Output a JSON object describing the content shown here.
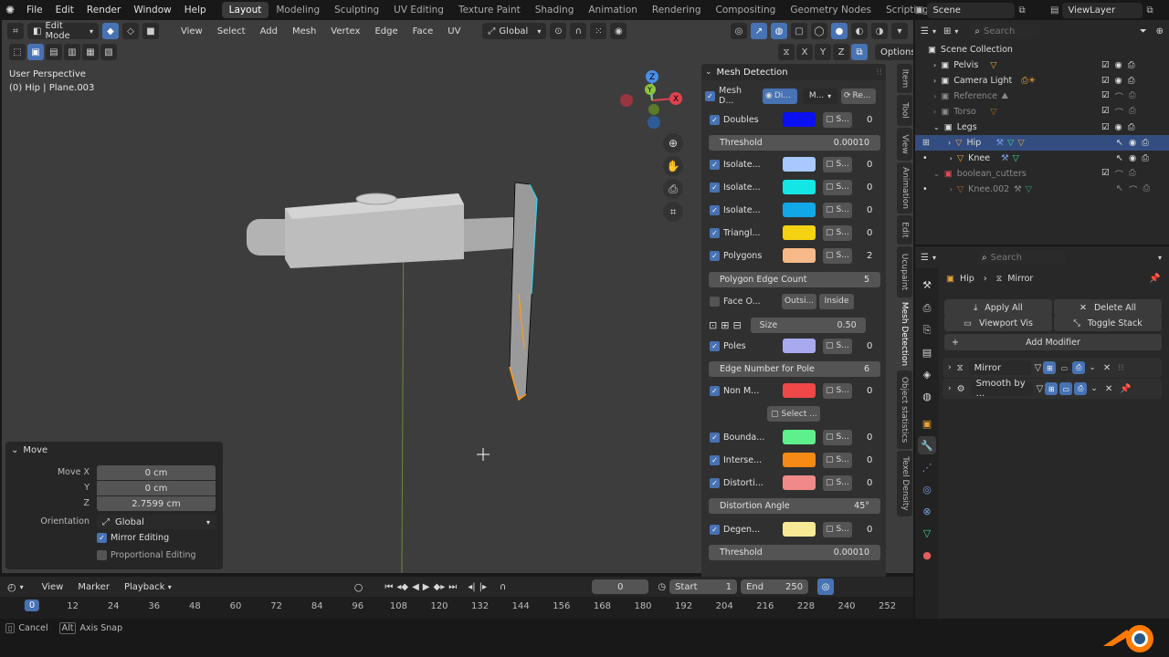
{
  "menubar": {
    "menus": [
      "File",
      "Edit",
      "Render",
      "Window",
      "Help"
    ],
    "workspaces": [
      "Layout",
      "Modeling",
      "Sculpting",
      "UV Editing",
      "Texture Paint",
      "Shading",
      "Animation",
      "Rendering",
      "Compositing",
      "Geometry Nodes",
      "Scripting"
    ],
    "active_workspace": "Layout",
    "scene": "Scene",
    "view_layer": "ViewLayer"
  },
  "viewport": {
    "mode": "Edit Mode",
    "menus": [
      "View",
      "Select",
      "Add",
      "Mesh",
      "Vertex",
      "Edge",
      "Face",
      "UV"
    ],
    "orientation": "Global",
    "axes": [
      "X",
      "Y",
      "Z"
    ],
    "options_label": "Options",
    "info_line1": "User Perspective",
    "info_line2": "(0) Hip | Plane.003",
    "gizmo": {
      "x": "X",
      "y": "Y",
      "z": "Z"
    }
  },
  "mesh_detection": {
    "title": "Mesh Detection",
    "header": {
      "name": "Mesh D...",
      "display": "Di...",
      "mode": "M...",
      "refresh": "Re..."
    },
    "select_label": "S...",
    "items": [
      {
        "label": "Doubles",
        "color": "#0a10f0",
        "count": "0",
        "checked": true
      },
      {
        "label": "Isolate...",
        "color": "#a9c8ff",
        "count": "0",
        "checked": true
      },
      {
        "label": "Isolate...",
        "color": "#14e6e6",
        "count": "0",
        "checked": true
      },
      {
        "label": "Isolate...",
        "color": "#12a8e8",
        "count": "0",
        "checked": true
      },
      {
        "label": "Triangl...",
        "color": "#f5d312",
        "count": "0",
        "checked": true
      },
      {
        "label": "Polygons",
        "color": "#f7b98a",
        "count": "2",
        "checked": true
      },
      {
        "label": "Poles",
        "color": "#a9a9f0",
        "count": "0",
        "checked": true
      },
      {
        "label": "Non M...",
        "color": "#f04848",
        "count": "0",
        "checked": true
      },
      {
        "label": "Bounda...",
        "color": "#5ef08c",
        "count": "0",
        "checked": true
      },
      {
        "label": "Interse...",
        "color": "#f58a14",
        "count": "0",
        "checked": true
      },
      {
        "label": "Distorti...",
        "color": "#f08a8a",
        "count": "0",
        "checked": true
      },
      {
        "label": "Degen...",
        "color": "#f7ea96",
        "count": "0",
        "checked": true
      }
    ],
    "threshold1": {
      "label": "Threshold",
      "value": "0.00010"
    },
    "polygon_edge_count": {
      "label": "Polygon Edge Count",
      "value": "5"
    },
    "face_orient": {
      "label": "Face O...",
      "outside": "Outsi...",
      "inside": "Inside"
    },
    "size": {
      "label": "Size",
      "value": "0.50"
    },
    "edge_number_pole": {
      "label": "Edge Number for Pole",
      "value": "6"
    },
    "select_all": "Select ...",
    "distortion_angle": {
      "label": "Distortion Angle",
      "value": "45°"
    },
    "threshold2": {
      "label": "Threshold",
      "value": "0.00010"
    }
  },
  "sidebar_tabs": [
    "Item",
    "Tool",
    "View",
    "Animation",
    "Edit",
    "Ucupaint",
    "Mesh Detection",
    "Object statistics",
    "Texel Density"
  ],
  "sidebar_active": "Mesh Detection",
  "move_panel": {
    "title": "Move",
    "move_x_label": "Move X",
    "move_x": "0 cm",
    "y_label": "Y",
    "y": "0 cm",
    "z_label": "Z",
    "z": "2.7599 cm",
    "orientation_label": "Orientation",
    "orientation": "Global",
    "mirror_editing": "Mirror Editing",
    "proportional_editing": "Proportional Editing"
  },
  "timeline": {
    "menus": [
      "View",
      "Marker",
      "Playback"
    ],
    "current_frame": "0",
    "start_label": "Start",
    "start": "1",
    "end_label": "End",
    "end": "250",
    "ruler": [
      "0",
      "12",
      "24",
      "36",
      "48",
      "60",
      "72",
      "84",
      "96",
      "108",
      "120",
      "132",
      "144",
      "156",
      "168",
      "180",
      "192",
      "204",
      "216",
      "228",
      "240",
      "252"
    ]
  },
  "statusbar": {
    "cancel": "Cancel",
    "alt_key": "Alt",
    "axis_snap": "Axis Snap"
  },
  "outliner": {
    "search_placeholder": "Search",
    "scene_collection": "Scene Collection",
    "rows": [
      {
        "label": "Pelvis",
        "dim": false
      },
      {
        "label": "Camera Light",
        "dim": false
      },
      {
        "label": "Reference",
        "dim": true
      },
      {
        "label": "Torso",
        "dim": true
      },
      {
        "label": "Legs",
        "dim": false
      },
      {
        "label": "Hip",
        "dim": false,
        "selected": true
      },
      {
        "label": "Knee",
        "dim": false
      },
      {
        "label": "boolean_cutters",
        "dim": true
      },
      {
        "label": "Knee.002",
        "dim": true
      }
    ]
  },
  "properties": {
    "search_placeholder": "Search",
    "object": "Hip",
    "modifier_breadcrumb": "Mirror",
    "apply_all": "Apply All",
    "delete_all": "Delete All",
    "viewport_vis": "Viewport Vis",
    "toggle_stack": "Toggle Stack",
    "add_modifier": "Add Modifier",
    "modifiers": [
      "Mirror",
      "Smooth by ..."
    ]
  }
}
